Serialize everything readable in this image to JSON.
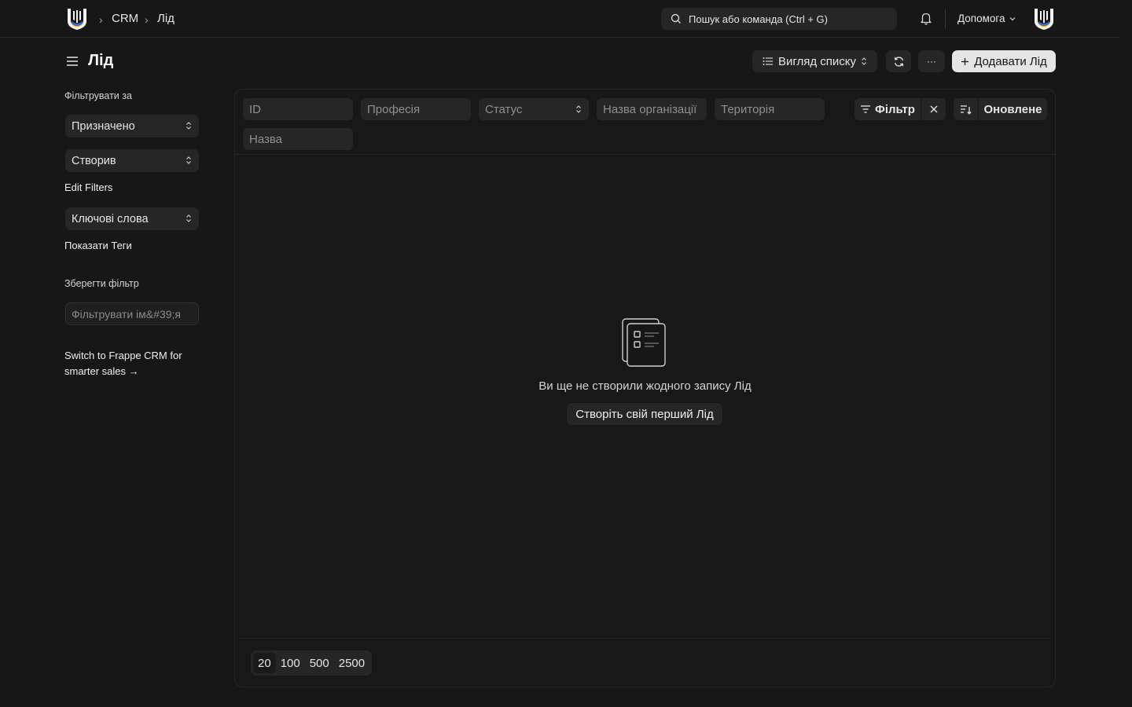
{
  "navbar": {
    "breadcrumbs": [
      "CRM",
      "Лід"
    ],
    "search_placeholder": "Пошук або команда (Ctrl + G)",
    "help_label": "Допомога"
  },
  "page": {
    "title": "Лід",
    "view_label": "Вигляд списку",
    "more_label": "···",
    "add_label": "Додавати Лід"
  },
  "sidebar": {
    "filter_by_label": "Фільтрувати за",
    "selects": [
      "Призначено",
      "Створив"
    ],
    "edit_filters": "Edit Filters",
    "keywords_select": "Ключові слова",
    "show_tags": "Показати Теги",
    "save_filter": "Зберегти фільтр",
    "filter_name_placeholder": "Фільтрувати ім&#39;я",
    "promo": "Switch to Frappe CRM for smarter sales →"
  },
  "filters": {
    "fields": [
      "ID",
      "Професія",
      "Статус",
      "Назва організації",
      "Територія",
      "Назва"
    ],
    "filter_button": "Фільтр",
    "sort_label": "Оновлене"
  },
  "empty_state": {
    "message": "Ви ще не створили жодного запису Лід",
    "create_button": "Створіть свій перший Лід"
  },
  "paging": {
    "options": [
      "20",
      "100",
      "500",
      "2500"
    ],
    "selected": "20"
  },
  "colors": {
    "background": "#171717",
    "surface": "#262626",
    "primary_button": "#e5e5e5"
  }
}
